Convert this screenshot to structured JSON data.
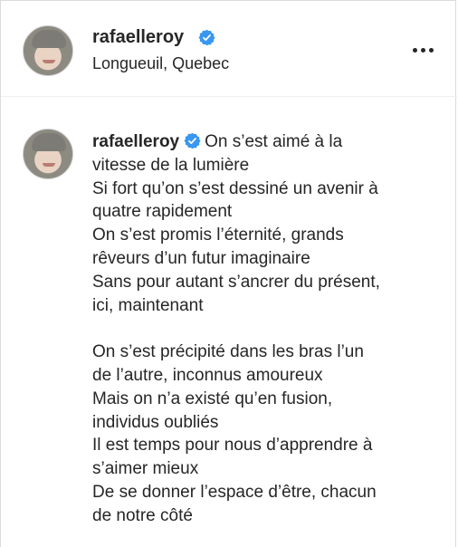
{
  "header": {
    "username": "rafaelleroy",
    "location": "Longueuil, Quebec",
    "verified": true,
    "more_icon": "more-horizontal-icon"
  },
  "post": {
    "username": "rafaelleroy",
    "verified": true,
    "caption_first_line": "On s’est aimé à la",
    "caption_rest": "vitesse de la lumière\nSi fort qu’on s’est dessiné un avenir à\nquatre rapidement\nOn s’est promis l’éternité, grands\nrêveurs d’un futur imaginaire\nSans pour autant s’ancrer du présent,\nici, maintenant\n\nOn s’est précipité dans les bras l’un\nde l’autre, inconnus amoureux\nMais on n’a existé qu’en fusion,\nindividus oubliés\nIl est temps pour nous d’apprendre à\ns’aimer mieux\nDe se donner l’espace d’être, chacun\nde notre côté"
  },
  "colors": {
    "verified_badge": "#3897f0",
    "text": "#262626",
    "border": "#dbdbdb"
  }
}
